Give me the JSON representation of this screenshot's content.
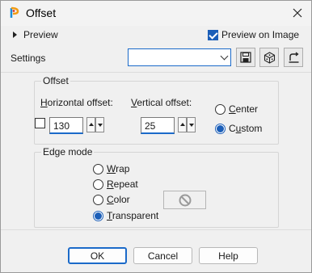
{
  "window": {
    "title": "Offset"
  },
  "icons": {
    "app": "app-logo-icon",
    "close": "close-icon",
    "save_preset": "floppy-save-icon",
    "randomize": "dice-randomize-icon",
    "reset": "reset-arrow-icon",
    "no_color": "no-color-icon"
  },
  "preview": {
    "label": "Preview",
    "preview_on_image_label": "Preview on Image",
    "preview_on_image_checked": true
  },
  "settings": {
    "label": "Settings",
    "value": ""
  },
  "offset": {
    "title": "Offset",
    "horizontal_label": "Horizontal offset:",
    "vertical_label": "Vertical offset:",
    "horizontal_value": "130",
    "vertical_value": "25",
    "center_label": "Center",
    "custom_label": "Custom",
    "selected": "Custom"
  },
  "edge_mode": {
    "title": "Edge mode",
    "options": [
      "Wrap",
      "Repeat",
      "Color",
      "Transparent"
    ],
    "selected": "Transparent"
  },
  "buttons": {
    "ok": "OK",
    "cancel": "Cancel",
    "help": "Help"
  },
  "colors": {
    "accent": "#1b6ac9",
    "checked": "#1b5eb8"
  }
}
